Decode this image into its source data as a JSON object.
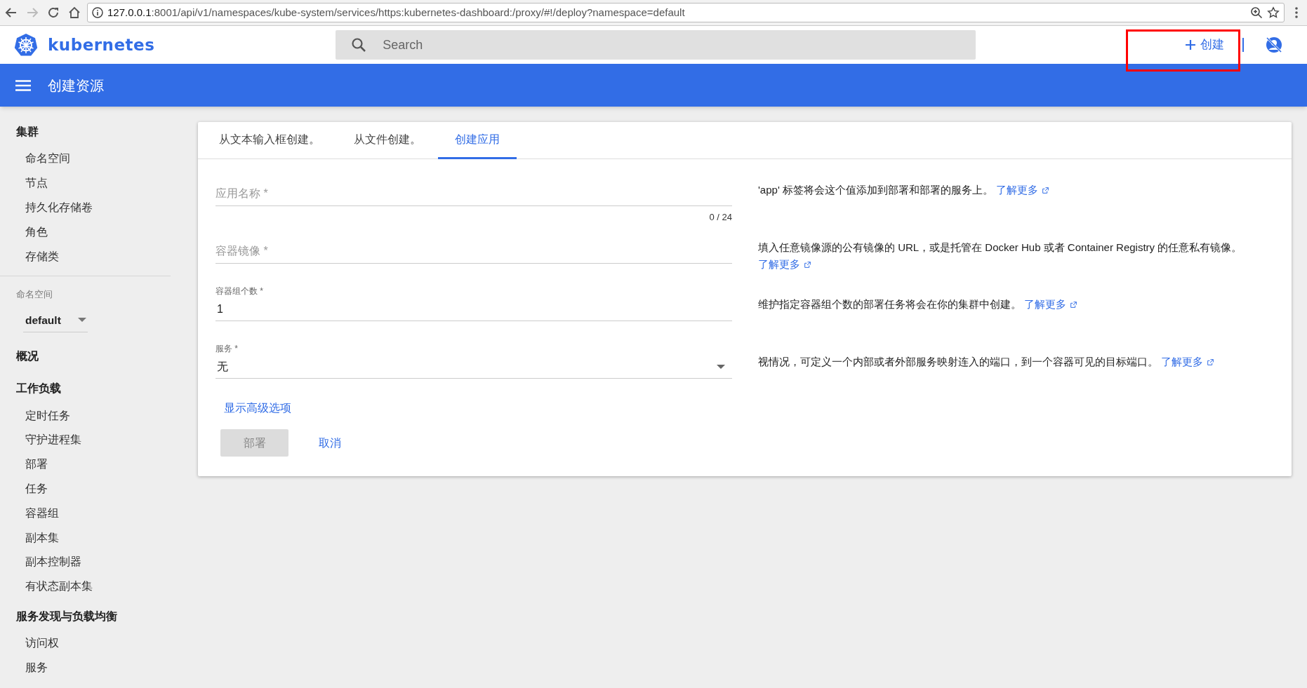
{
  "browser": {
    "url_host": "127.0.0.1",
    "url_path": ":8001/api/v1/namespaces/kube-system/services/https:kubernetes-dashboard:/proxy/#!/deploy?namespace=default"
  },
  "header": {
    "logo_text": "kubernetes",
    "search_placeholder": "Search",
    "create_button": {
      "label": "创建",
      "highlighted": true
    }
  },
  "toolbar": {
    "title": "创建资源"
  },
  "sidebar": {
    "top_sections": [
      {
        "title": "集群",
        "items": [
          {
            "label": "命名空间",
            "selected": false
          },
          {
            "label": "节点",
            "selected": false
          },
          {
            "label": "持久化存储卷",
            "selected": false
          },
          {
            "label": "角色",
            "selected": false
          },
          {
            "label": "存储类",
            "selected": false
          }
        ]
      }
    ],
    "namespace": {
      "label": "命名空间",
      "value": "default"
    },
    "sections": [
      {
        "title": "概况"
      },
      {
        "title": "工作负载",
        "items": [
          {
            "label": "定时任务",
            "selected": false
          },
          {
            "label": "守护进程集",
            "selected": false
          },
          {
            "label": "部署",
            "selected": false
          },
          {
            "label": "任务",
            "selected": false
          },
          {
            "label": "容器组",
            "selected": false
          },
          {
            "label": "副本集",
            "selected": false
          },
          {
            "label": "副本控制器",
            "selected": false
          },
          {
            "label": "有状态副本集",
            "selected": false
          }
        ]
      },
      {
        "title": "服务发现与负载均衡",
        "items": [
          {
            "label": "访问权",
            "selected": false
          },
          {
            "label": "服务",
            "selected": false
          }
        ]
      }
    ]
  },
  "tabs": [
    {
      "label": "从文本输入框创建。",
      "selected": false
    },
    {
      "label": "从文件创建。",
      "selected": false
    },
    {
      "label": "创建应用",
      "selected": true
    }
  ],
  "fields": [
    {
      "kind": "text",
      "placeholder": "应用名称 *",
      "counter": "0 / 24",
      "help": "'app' 标签将会这个值添加到部署和部署的服务上。",
      "link": "了解更多"
    },
    {
      "kind": "text",
      "placeholder": "容器镜像 *",
      "help": "填入任意镜像源的公有镜像的 URL，或是托管在 Docker Hub 或者 Container Registry 的任意私有镜像。",
      "link": "了解更多"
    },
    {
      "kind": "number",
      "label": "容器组个数 *",
      "value": "1",
      "help": "维护指定容器组个数的部署任务将会在你的集群中创建。",
      "link": "了解更多"
    },
    {
      "kind": "select",
      "label": "服务 *",
      "value": "无",
      "help": "视情况，可定义一个内部或者外部服务映射连入的端口，到一个容器可见的目标端口。",
      "link": "了解更多"
    }
  ],
  "advanced_link": "显示高级选项",
  "deploy_button": {
    "label": "部署",
    "disabled": true
  },
  "cancel_button": "取消"
}
